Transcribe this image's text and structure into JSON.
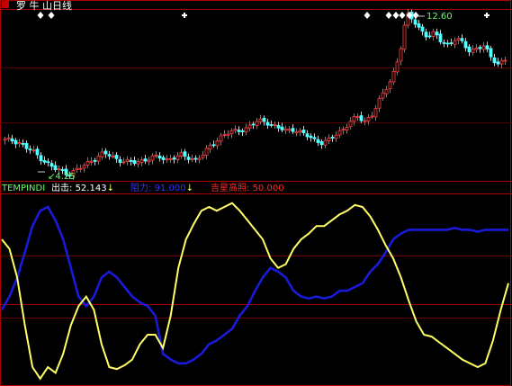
{
  "header": {
    "title": "罗 牛 山日线",
    "icon": "red-square-icon"
  },
  "indicator_legend": {
    "name": "TEMPINDI",
    "items": [
      {
        "label": "出击",
        "value": "52.143",
        "arrow": "↓",
        "color": "#ffffff",
        "arrow_color": "#ffff66"
      },
      {
        "label": "阻力",
        "value": "91.000",
        "arrow": "↓",
        "color": "#3333ff",
        "arrow_color": "#ffff66"
      },
      {
        "label": "吉星高照",
        "value": "50.000",
        "arrow": "",
        "color": "#ff2a2a",
        "arrow_color": "#ffff66"
      }
    ]
  },
  "annotations": {
    "high_label": "12.60",
    "low_label": "4.25"
  },
  "colors": {
    "background": "#000000",
    "frame": "#aa0000",
    "up_candle": "#ff4040",
    "down_candle": "#54ffff",
    "chuji_line": "#ffff66",
    "zuli_line": "#1a1ad9",
    "ref_line": "#aa0000"
  },
  "chart_data": [
    {
      "type": "candlestick",
      "title": "罗 牛 山日线",
      "close_approx": [
        6.0,
        6.0,
        5.9,
        5.6,
        5.4,
        5.1,
        4.8,
        4.5,
        4.4,
        4.25,
        4.4,
        4.6,
        4.9,
        5.1,
        5.3,
        5.2,
        5.0,
        4.9,
        4.8,
        4.9,
        5.0,
        5.1,
        5.1,
        5.0,
        5.1,
        5.2,
        5.1,
        5.0,
        5.2,
        5.6,
        6.0,
        6.3,
        6.4,
        6.5,
        6.6,
        6.8,
        7.0,
        7.0,
        6.8,
        6.6,
        6.5,
        6.6,
        6.4,
        6.2,
        6.0,
        5.9,
        6.0,
        6.3,
        6.6,
        7.0,
        7.2,
        7.0,
        7.3,
        8.0,
        8.6,
        9.4,
        10.5,
        12.6,
        12.3,
        11.8,
        11.4,
        11.6,
        11.2,
        11.0,
        11.3,
        11.1,
        10.7,
        10.8,
        10.9,
        10.4,
        10.0,
        10.2
      ],
      "high_label": 12.6,
      "low_label": 4.25,
      "markers": [
        "diamond",
        "diamond",
        "cross",
        "diamond",
        "diamond",
        "diamond",
        "diamond",
        "diamond",
        "diamond",
        "cross"
      ]
    },
    {
      "type": "line",
      "title": "TEMPINDI",
      "ylim": [
        0,
        100
      ],
      "reference_lines": [
        52.143,
        50.0
      ],
      "series": [
        {
          "name": "出击",
          "color": "#ffff66",
          "values": [
            75,
            70,
            55,
            30,
            8,
            2,
            8,
            5,
            15,
            30,
            40,
            45,
            38,
            20,
            8,
            7,
            9,
            12,
            20,
            25,
            25,
            18,
            35,
            60,
            75,
            83,
            90,
            92,
            90,
            92,
            94,
            90,
            85,
            80,
            75,
            65,
            60,
            62,
            70,
            75,
            78,
            82,
            82,
            85,
            88,
            90,
            93,
            92,
            87,
            80,
            72,
            65,
            55,
            43,
            32,
            25,
            24,
            21,
            18,
            15,
            12,
            10,
            8,
            10,
            22,
            38,
            52
          ]
        },
        {
          "name": "阻力",
          "color": "#1a1ad9",
          "values": [
            38,
            45,
            55,
            68,
            82,
            90,
            92,
            85,
            75,
            60,
            45,
            40,
            45,
            55,
            58,
            55,
            50,
            45,
            42,
            40,
            35,
            15,
            12,
            10,
            10,
            12,
            15,
            20,
            22,
            25,
            28,
            35,
            40,
            48,
            55,
            60,
            58,
            55,
            48,
            45,
            44,
            45,
            44,
            45,
            48,
            48,
            50,
            52,
            58,
            62,
            68,
            75,
            78,
            80,
            80,
            80,
            80,
            80,
            80,
            81,
            80,
            80,
            79,
            80,
            80,
            80,
            80
          ]
        }
      ]
    }
  ]
}
